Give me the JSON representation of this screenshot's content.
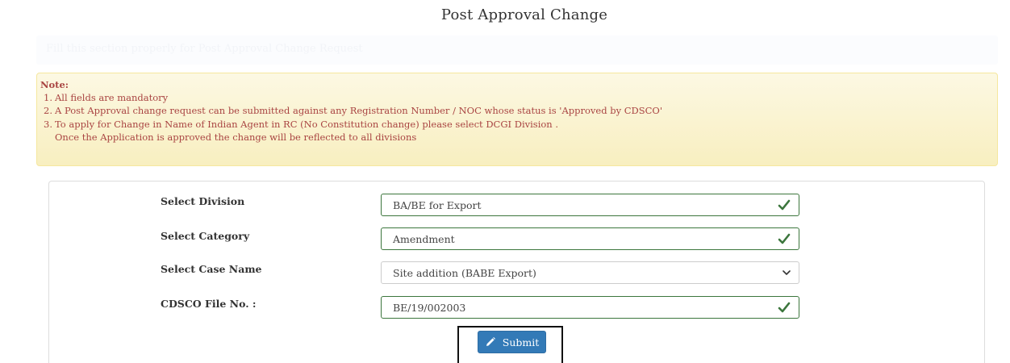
{
  "page": {
    "title": "Post Approval Change",
    "faded_banner_text": "Fill this section properly for Post Approval Change Request"
  },
  "note": {
    "title": "Note:",
    "items": [
      {
        "num": "1.",
        "text": "All fields are mandatory"
      },
      {
        "num": "2.",
        "text": "A Post Approval change request can be submitted against any Registration Number / NOC whose status is 'Approved by CDSCO'"
      },
      {
        "num": "3.",
        "text": "To apply for Change in Name of Indian Agent in RC (No Constitution change) please select DCGI Division ."
      }
    ],
    "continuation": "Once the Application is approved the change will be reflected to all divisions"
  },
  "form": {
    "division": {
      "label": "Select Division",
      "value": "BA/BE for Export",
      "icon": "check-icon"
    },
    "category": {
      "label": "Select Category",
      "value": "Amendment",
      "icon": "check-icon"
    },
    "case_name": {
      "label": "Select Case Name",
      "value": "Site addition (BABE Export)",
      "icon": "chevron-down-icon"
    },
    "file_no": {
      "label": "CDSCO File No. :",
      "value": "BE/19/002003",
      "icon": "check-icon"
    },
    "submit_label": "Submit"
  },
  "colors": {
    "note_text": "#a94442",
    "note_bg": "#fcf8e3",
    "valid_border": "#3c763d",
    "valid_check": "#3c763d",
    "button_bg": "#337ab7"
  }
}
